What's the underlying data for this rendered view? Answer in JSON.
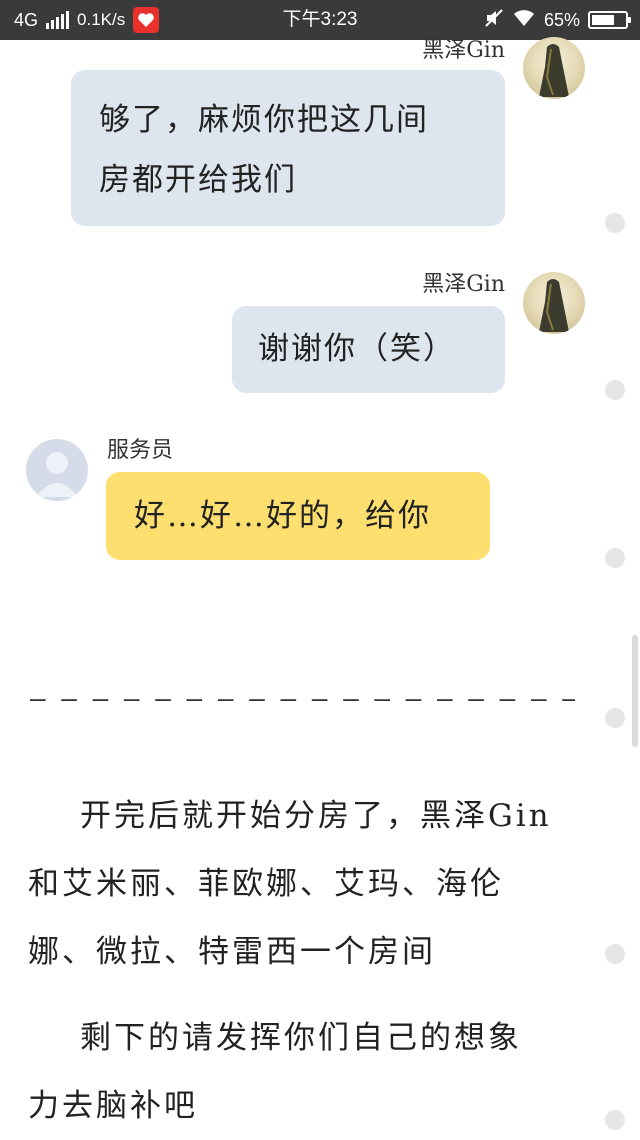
{
  "status_bar": {
    "network": "4G",
    "speed": "0.1K/s",
    "time": "下午3:23",
    "battery": "65%",
    "battery_level": 0.65
  },
  "messages": [
    {
      "sender": "黑泽Gin",
      "text": "够了，麻烦你把这几间房都开给我们",
      "line1": "够了，麻烦你把这几间",
      "line2": "房都开给我们",
      "side": "right"
    },
    {
      "sender": "黑泽Gin",
      "text": "谢谢你（笑）",
      "side": "right"
    },
    {
      "sender": "服务员",
      "text": "好…好…好的，给你",
      "side": "left"
    }
  ],
  "divider": "— — — — — — — — — — — — — — — — — — — —",
  "narration": [
    {
      "line1": "开完后就开始分房了，黑泽Gin",
      "line2": "和艾米丽、菲欧娜、艾玛、海伦",
      "line3": "娜、微拉、特雷西一个房间"
    },
    {
      "line1": "剩下的请发挥你们自己的想象",
      "line2": "力去脑补吧"
    }
  ]
}
